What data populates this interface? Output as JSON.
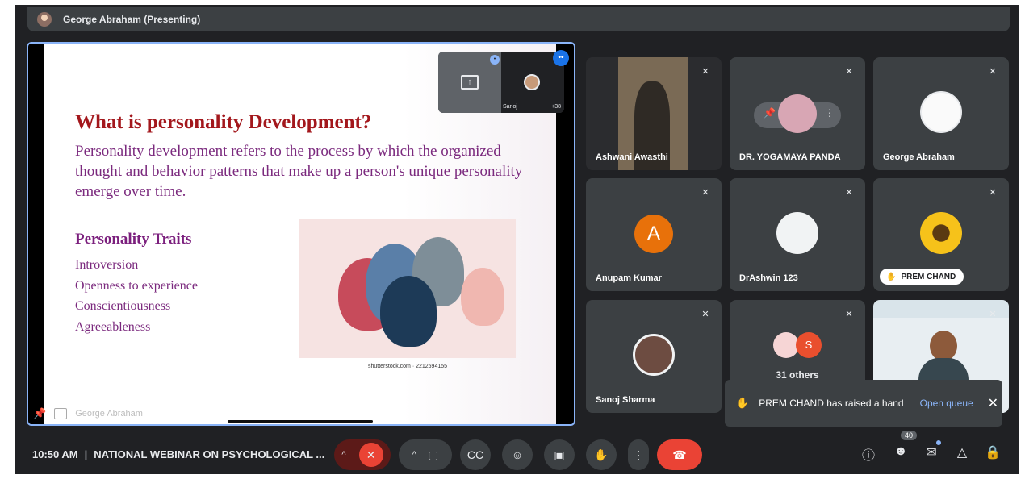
{
  "presenter": {
    "label": "George Abraham (Presenting)"
  },
  "slide": {
    "title": "What is personality Development?",
    "intro": "Personality development refers to the process by which the organized thought and behavior patterns that make up a person's unique personality emerge over time.",
    "traits_heading": "Personality Traits",
    "traits": [
      "Introversion",
      "Openness to experience",
      "Conscientiousness",
      "Agreeableness"
    ],
    "image_credit": "shutterstock.com · 2212594155",
    "owner_label": "George Abraham"
  },
  "pip": {
    "self_name": "Sanoj",
    "count": "+38"
  },
  "tiles": [
    {
      "name": "Ashwani Awasthi"
    },
    {
      "name": "DR. YOGAMAYA PANDA"
    },
    {
      "name": "George Abraham"
    },
    {
      "name": "Anupam Kumar",
      "initial": "A"
    },
    {
      "name": "DrAshwin 123"
    },
    {
      "name": "PREM CHAND"
    },
    {
      "name": "Sanoj Sharma"
    },
    {
      "name": "31 others",
      "initial": "S"
    },
    {
      "name": ""
    }
  ],
  "toast": {
    "message": "PREM CHAND has raised a hand",
    "action": "Open queue"
  },
  "bottom": {
    "time": "10:50 AM",
    "meeting_title": "NATIONAL WEBINAR ON PSYCHOLOGICAL ...",
    "participants_count": "40"
  },
  "icons": [
    "pin-icon",
    "mic-off-icon",
    "camera-icon",
    "captions-icon",
    "emoji-icon",
    "present-icon",
    "raise-hand-icon",
    "more-icon",
    "end-call-icon",
    "info-icon",
    "people-icon",
    "chat-icon",
    "activities-icon",
    "lock-icon"
  ],
  "colors": {
    "slide_title": "#a3171c",
    "slide_text": "#7b2a7e",
    "accent_blue": "#8ab4f8",
    "end_call": "#ea4335",
    "avatar_orange": "#e8710a"
  }
}
